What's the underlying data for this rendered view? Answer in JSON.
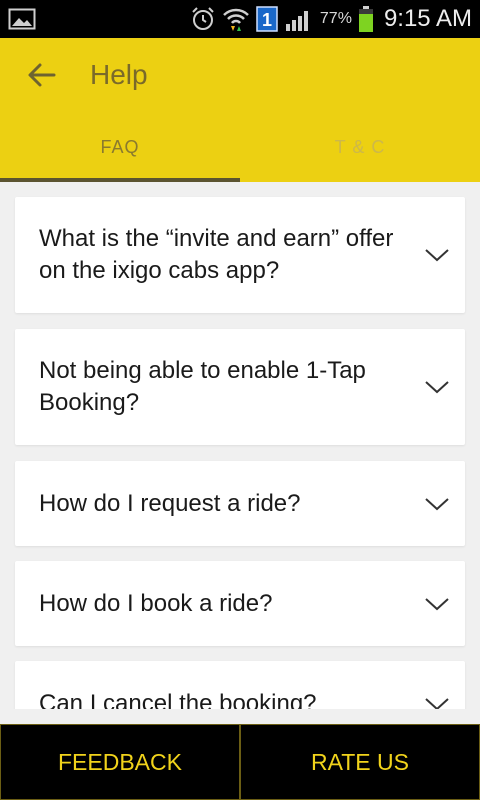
{
  "status_bar": {
    "battery_percent": "77%",
    "time": "9:15 AM",
    "notification_badge": "1",
    "icons": [
      "image-icon",
      "alarm-icon",
      "wifi-icon",
      "sim-badge-icon",
      "signal-icon",
      "battery-icon"
    ]
  },
  "header": {
    "title": "Help",
    "back_icon": "arrow-left-icon",
    "accent_color": "#ecd012"
  },
  "tabs": [
    {
      "label": "FAQ",
      "active": true
    },
    {
      "label": "T & C",
      "active": false
    }
  ],
  "faqs": [
    {
      "question": "What is the “invite and earn” offer on the ixigo cabs app?"
    },
    {
      "question": "Not being able to enable 1-Tap Booking?"
    },
    {
      "question": "How do I request a ride?"
    },
    {
      "question": "How do I book a ride?"
    },
    {
      "question": "Can I cancel the booking?"
    }
  ],
  "footer": {
    "feedback_label": "FEEDBACK",
    "rate_label": "RATE US"
  }
}
